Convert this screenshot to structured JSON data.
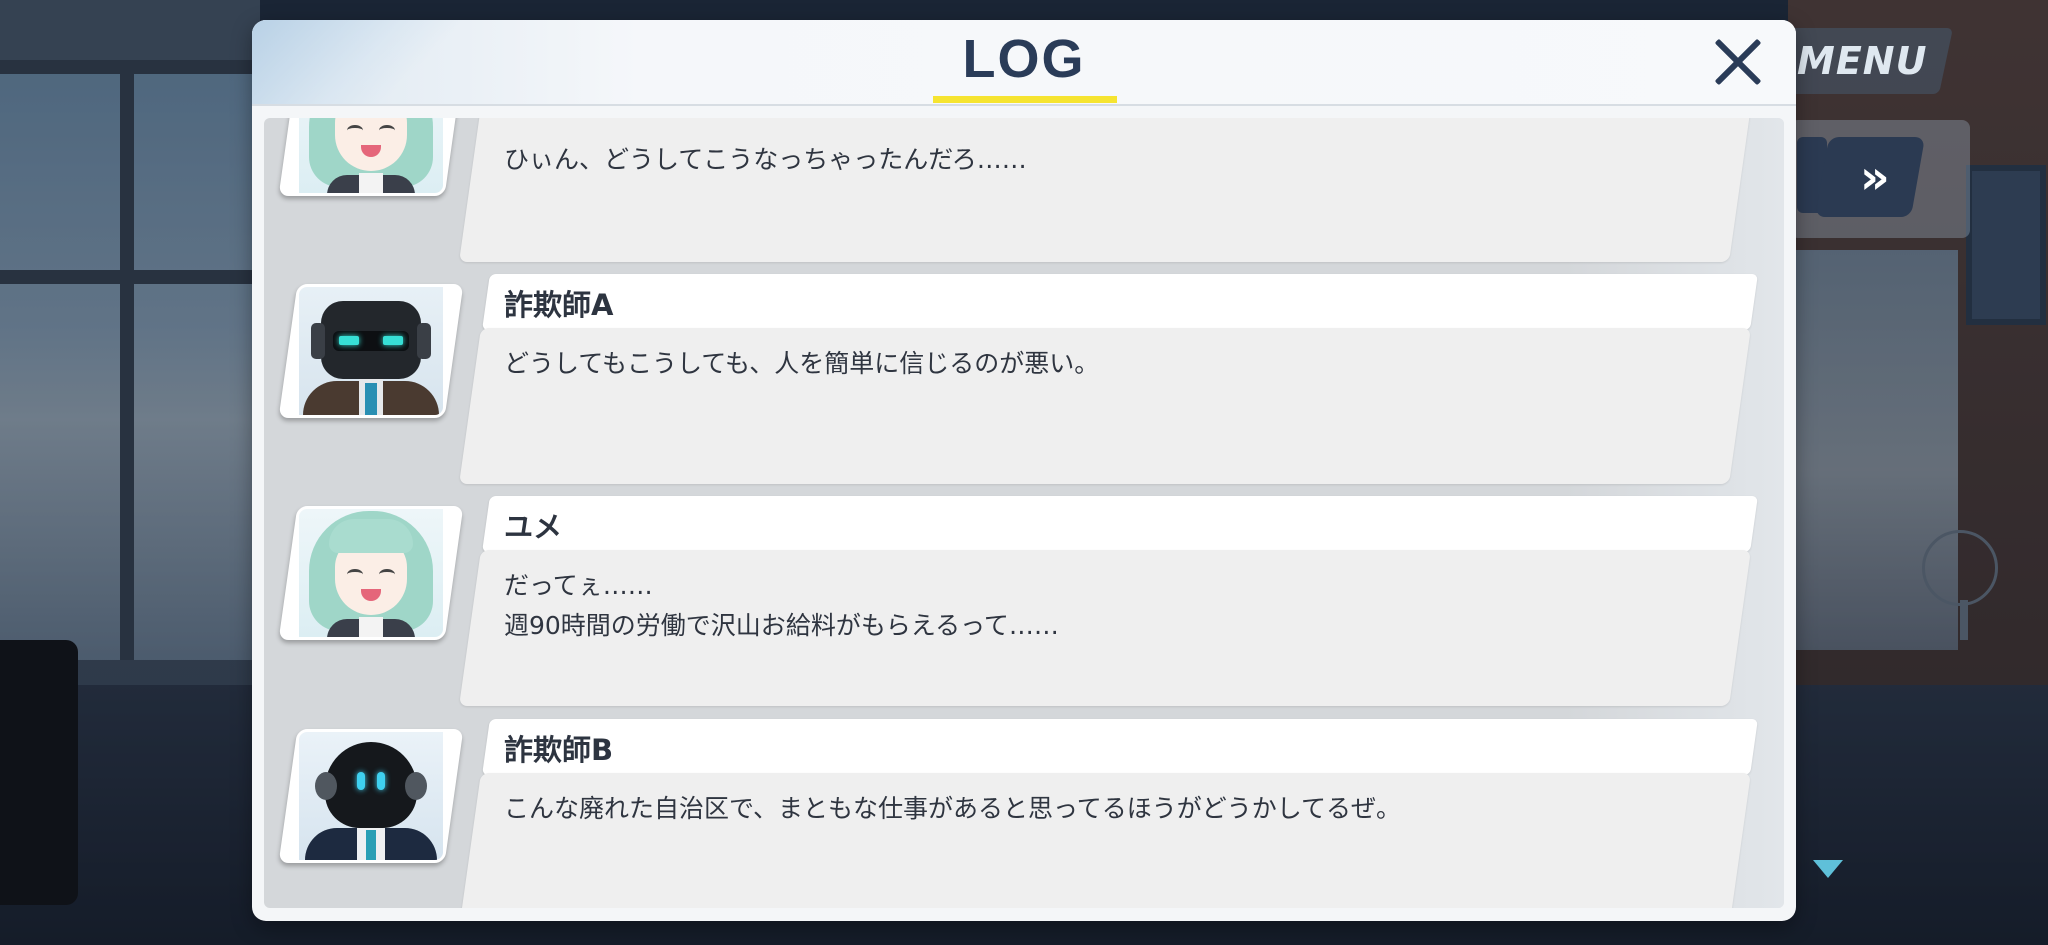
{
  "hud": {
    "menu_label": "MENU",
    "skip_label": "»"
  },
  "log": {
    "title": "LOG",
    "accent_color": "#f6e430",
    "title_color": "#2a3c58",
    "entries": [
      {
        "speaker": "",
        "avatar": "yume-avatar",
        "lines": [
          "ひぃん、どうしてこうなっちゃったんだろ……"
        ]
      },
      {
        "speaker": "詐欺師A",
        "avatar": "robot-a-avatar",
        "lines": [
          "どうしてもこうしても、人を簡単に信じるのが悪い。"
        ]
      },
      {
        "speaker": "ユメ",
        "avatar": "yume-avatar",
        "lines": [
          "だってぇ……",
          "週90時間の労働で沢山お給料がもらえるって……"
        ]
      },
      {
        "speaker": "詐欺師B",
        "avatar": "robot-b-avatar",
        "lines": [
          "こんな廃れた自治区で、まともな仕事があると思ってるほうがどうかしてるぜ。"
        ]
      }
    ]
  }
}
